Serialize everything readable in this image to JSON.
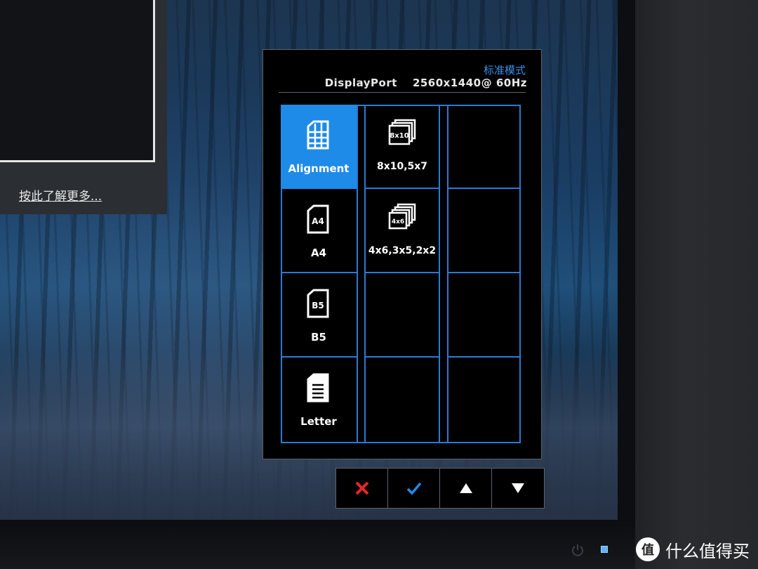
{
  "background_window": {
    "learn_more_link": "按此了解更多..."
  },
  "osd": {
    "mode_name": "标准模式",
    "input_source": "DisplayPort",
    "resolution": "2560x1440@ 60Hz",
    "main_menu": [
      {
        "label": "Alignment",
        "icon": "grid-page-icon",
        "selected": true
      },
      {
        "label": "A4",
        "icon": "a4-page-icon",
        "selected": false
      },
      {
        "label": "B5",
        "icon": "b5-page-icon",
        "selected": false
      },
      {
        "label": "Letter",
        "icon": "letter-page-icon",
        "selected": false
      }
    ],
    "submenu": [
      {
        "label": "8x10,5x7",
        "icon": "8x10-photo-stack-icon"
      },
      {
        "label": "4x6,3x5,2x2",
        "icon": "4x6-photo-stack-icon"
      }
    ],
    "icon_texts": {
      "a4": "A4",
      "b5": "B5",
      "photo_8x10": "8x10",
      "photo_4x6": "4x6"
    },
    "accent_color": "#1e8be8",
    "border_color": "#2b7ad6"
  },
  "control_buttons": [
    {
      "name": "cancel",
      "icon": "close-icon",
      "color": "#e8262b"
    },
    {
      "name": "confirm",
      "icon": "checkmark-icon",
      "color": "#1e8be8"
    },
    {
      "name": "up",
      "icon": "arrow-up-icon",
      "color": "#ffffff"
    },
    {
      "name": "down",
      "icon": "arrow-down-icon",
      "color": "#ffffff"
    }
  ],
  "watermark": {
    "text": "什么值得买",
    "logo_text": "值"
  }
}
